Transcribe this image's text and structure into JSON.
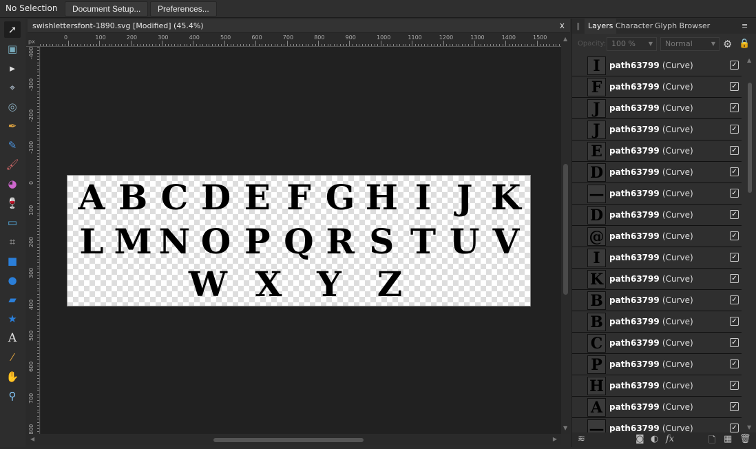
{
  "context_bar": {
    "selection": "No Selection",
    "document_setup": "Document Setup...",
    "preferences": "Preferences..."
  },
  "document": {
    "title": "swishlettersfont-1890.svg [Modified] (45.4%)",
    "close": "x"
  },
  "rulers": {
    "unit": "px",
    "horizontal": [
      "0",
      "100",
      "200",
      "300",
      "400",
      "500",
      "600",
      "700",
      "800",
      "900",
      "1000",
      "1100",
      "1200",
      "1300",
      "1400",
      "1500"
    ],
    "vertical": [
      "-400",
      "-300",
      "-200",
      "-100",
      "0",
      "100",
      "200",
      "300",
      "400",
      "500",
      "600",
      "700",
      "800"
    ]
  },
  "tools": [
    "move-tool",
    "artboard-tool",
    "node-tool",
    "corner-tool",
    "point-transform-tool",
    "pen-tool",
    "pencil-tool",
    "vector-brush-tool",
    "fill-tool",
    "transparency-tool",
    "place-image-tool",
    "crop-tool",
    "rectangle-tool",
    "ellipse-tool",
    "rounded-rectangle-tool",
    "star-tool",
    "text-tool",
    "color-picker-tool",
    "view-tool",
    "zoom-tool"
  ],
  "artwork": {
    "row1": [
      "A",
      "B",
      "C",
      "D",
      "E",
      "F",
      "G",
      "H",
      "I",
      "J",
      "K"
    ],
    "row2": [
      "L",
      "M",
      "N",
      "O",
      "P",
      "Q",
      "R",
      "S",
      "T",
      "U",
      "V"
    ],
    "row3": [
      "W",
      "X",
      "Y",
      "Z"
    ]
  },
  "panel": {
    "tabs": [
      "Layers",
      "Character",
      "Glyph Browser"
    ],
    "active_tab": "Layers",
    "opacity_label": "Opacity:",
    "opacity": "100 %",
    "blend_mode": "Normal",
    "layers": [
      {
        "name": "path63799",
        "type": "(Curve)",
        "visible": true,
        "thumb": "I"
      },
      {
        "name": "path63799",
        "type": "(Curve)",
        "visible": true,
        "thumb": "F"
      },
      {
        "name": "path63799",
        "type": "(Curve)",
        "visible": true,
        "thumb": "J"
      },
      {
        "name": "path63799",
        "type": "(Curve)",
        "visible": true,
        "thumb": "J"
      },
      {
        "name": "path63799",
        "type": "(Curve)",
        "visible": true,
        "thumb": "E"
      },
      {
        "name": "path63799",
        "type": "(Curve)",
        "visible": true,
        "thumb": "D"
      },
      {
        "name": "path63799",
        "type": "(Curve)",
        "visible": true,
        "thumb": "—"
      },
      {
        "name": "path63799",
        "type": "(Curve)",
        "visible": true,
        "thumb": "D"
      },
      {
        "name": "path63799",
        "type": "(Curve)",
        "visible": true,
        "thumb": "@"
      },
      {
        "name": "path63799",
        "type": "(Curve)",
        "visible": true,
        "thumb": "I"
      },
      {
        "name": "path63799",
        "type": "(Curve)",
        "visible": true,
        "thumb": "K"
      },
      {
        "name": "path63799",
        "type": "(Curve)",
        "visible": true,
        "thumb": "B"
      },
      {
        "name": "path63799",
        "type": "(Curve)",
        "visible": true,
        "thumb": "B"
      },
      {
        "name": "path63799",
        "type": "(Curve)",
        "visible": true,
        "thumb": "C"
      },
      {
        "name": "path63799",
        "type": "(Curve)",
        "visible": true,
        "thumb": "P"
      },
      {
        "name": "path63799",
        "type": "(Curve)",
        "visible": true,
        "thumb": "H"
      },
      {
        "name": "path63799",
        "type": "(Curve)",
        "visible": true,
        "thumb": "A"
      },
      {
        "name": "path63799",
        "type": "(Curve)",
        "visible": true,
        "thumb": "—"
      }
    ],
    "bottom_icons": [
      "layers-stack-icon",
      "mask-icon",
      "adjustment-icon",
      "fx-icon",
      "add-layer-icon",
      "add-pixel-layer-icon",
      "trash-icon"
    ],
    "fx_label": "fx"
  }
}
